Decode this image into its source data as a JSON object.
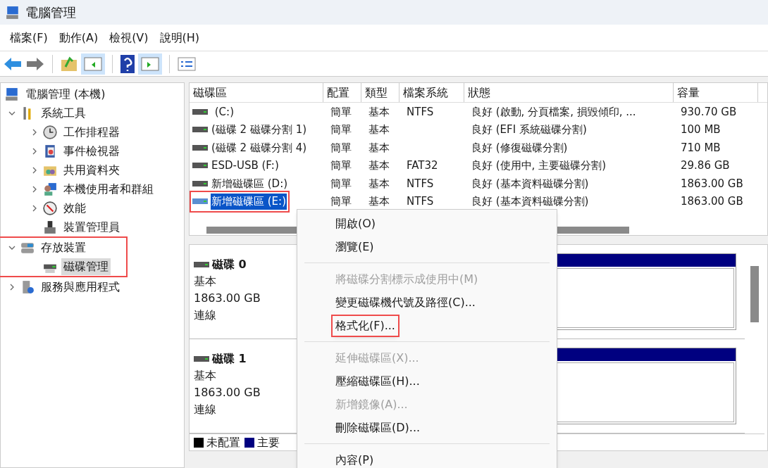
{
  "window": {
    "title": "電腦管理"
  },
  "menu_bar": [
    "檔案(F)",
    "動作(A)",
    "檢視(V)",
    "說明(H)"
  ],
  "tree": [
    {
      "label": "電腦管理 (本機)",
      "selected": false,
      "children": [
        {
          "label": "系統工具",
          "expanded": true,
          "selected": false,
          "children": [
            {
              "label": "工作排程器",
              "expanded": false,
              "selected": false
            },
            {
              "label": "事件檢視器",
              "expanded": false,
              "selected": false
            },
            {
              "label": "共用資料夾",
              "expanded": false,
              "selected": false
            },
            {
              "label": "本機使用者和群組",
              "expanded": false,
              "selected": false
            },
            {
              "label": "效能",
              "expanded": false,
              "selected": false
            },
            {
              "label": "裝置管理員",
              "selected": false
            }
          ]
        },
        {
          "label": "存放裝置",
          "expanded": true,
          "selected": false,
          "highlighted": true,
          "children": [
            {
              "label": "磁碟管理",
              "selected": true
            }
          ]
        },
        {
          "label": "服務與應用程式",
          "expanded": false,
          "selected": false
        }
      ]
    }
  ],
  "table": {
    "columns": [
      "磁碟區",
      "配置",
      "類型",
      "檔案系統",
      "狀態",
      "容量"
    ],
    "rows": [
      {
        "cells": [
          " (C:)",
          "簡單",
          "基本",
          "NTFS",
          "良好 (啟動, 分頁檔案, 損毀傾印, ...",
          "930.70 GB"
        ],
        "selected": false,
        "highlighted": false
      },
      {
        "cells": [
          "(磁碟 2 磁碟分割 1)",
          "簡單",
          "基本",
          "",
          "良好 (EFI 系統磁碟分割)",
          "100 MB"
        ],
        "selected": false,
        "highlighted": false
      },
      {
        "cells": [
          "(磁碟 2 磁碟分割 4)",
          "簡單",
          "基本",
          "",
          "良好 (修復磁碟分割)",
          "710 MB"
        ],
        "selected": false,
        "highlighted": false
      },
      {
        "cells": [
          "ESD-USB (F:)",
          "簡單",
          "基本",
          "FAT32",
          "良好 (使用中, 主要磁碟分割)",
          "29.86 GB"
        ],
        "selected": false,
        "highlighted": false
      },
      {
        "cells": [
          "新增磁碟區 (D:)",
          "簡單",
          "基本",
          "NTFS",
          "良好 (基本資料磁碟分割)",
          "1863.00 GB"
        ],
        "selected": false,
        "highlighted": false
      },
      {
        "cells": [
          "新增磁碟區 (E:)",
          "簡單",
          "基本",
          "NTFS",
          "良好 (基本資料磁碟分割)",
          "1863.00 GB"
        ],
        "selected": true,
        "highlighted": true
      }
    ]
  },
  "disks": [
    {
      "name": "磁碟 0",
      "type": "基本",
      "size": "1863.00 GB",
      "status": "連線"
    },
    {
      "name": "磁碟 1",
      "type": "基本",
      "size": "1863.00 GB",
      "status": "連線"
    }
  ],
  "legend": [
    {
      "label": "未配置",
      "color": "#000000"
    },
    {
      "label": "主要",
      "color": "#000080"
    }
  ],
  "context_menu": [
    {
      "kind": "item",
      "label": "開啟(O)",
      "disabled": false,
      "highlighted": false
    },
    {
      "kind": "item",
      "label": "瀏覽(E)",
      "disabled": false,
      "highlighted": false
    },
    {
      "kind": "separator"
    },
    {
      "kind": "item",
      "label": "將磁碟分割標示成使用中(M)",
      "disabled": true,
      "highlighted": false
    },
    {
      "kind": "item",
      "label": "變更磁碟機代號及路徑(C)...",
      "disabled": false,
      "highlighted": false
    },
    {
      "kind": "item",
      "label": "格式化(F)...",
      "disabled": false,
      "highlighted": true
    },
    {
      "kind": "separator"
    },
    {
      "kind": "item",
      "label": "延伸磁碟區(X)...",
      "disabled": true,
      "highlighted": false
    },
    {
      "kind": "item",
      "label": "壓縮磁碟區(H)...",
      "disabled": false,
      "highlighted": false
    },
    {
      "kind": "item",
      "label": "新增鏡像(A)...",
      "disabled": true,
      "highlighted": false
    },
    {
      "kind": "item",
      "label": "刪除磁碟區(D)...",
      "disabled": false,
      "highlighted": false
    },
    {
      "kind": "separator"
    },
    {
      "kind": "item",
      "label": "內容(P)",
      "disabled": false,
      "highlighted": false
    }
  ]
}
